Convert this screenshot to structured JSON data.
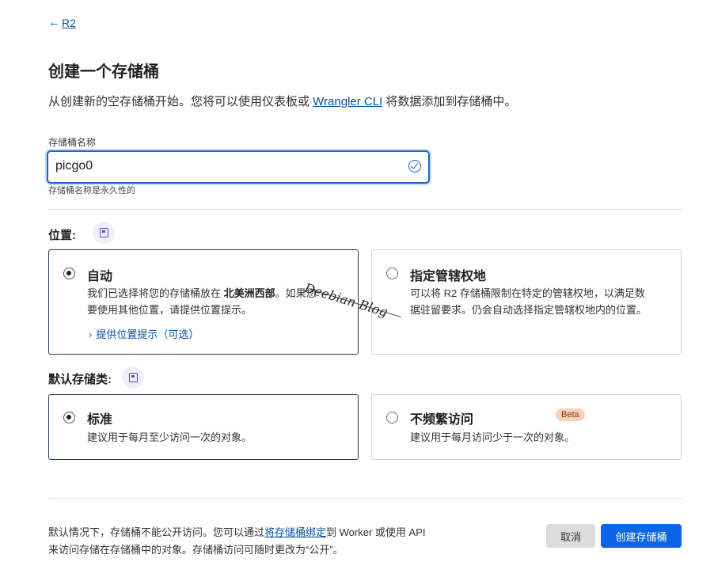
{
  "back": {
    "arrow": "←",
    "label": "R2"
  },
  "page": {
    "title": "创建一个存储桶",
    "subtitle_before": "从创建新的空存储桶开始。您将可以使用仪表板或 ",
    "subtitle_link": "Wrangler CLI",
    "subtitle_after": " 将数据添加到存储桶中。"
  },
  "bucket_name": {
    "label": "存储桶名称",
    "value": "picgo0",
    "hint": "存储桶名称是永久性的",
    "valid_icon": "check-circle-icon"
  },
  "location": {
    "label": "位置:",
    "options": [
      {
        "title": "自动",
        "desc_line1_before": "我们已选择将您的存储桶放在 ",
        "desc_line1_bold": "北美洲西部",
        "desc_line1_after": "。如果您",
        "desc_line2": "要使用其他位置，请提供位置提示。",
        "expander": "提供位置提示（可选）",
        "selected": true
      },
      {
        "title": "指定管辖权地",
        "desc_line1": "可以将 R2 存储桶限制在特定的管辖权地，以满足数",
        "desc_line2": "据驻留要求。仍会自动选择指定管辖权地内的位置。",
        "selected": false
      }
    ]
  },
  "storage_class": {
    "label": "默认存储类:",
    "options": [
      {
        "title": "标准",
        "desc": "建议用于每月至少访问一次的对象。",
        "selected": true
      },
      {
        "title": "不频繁访问",
        "badge": "Beta",
        "desc": "建议用于每月访问少于一次的对象。",
        "selected": false
      }
    ]
  },
  "footer": {
    "line1_before": "默认情况下，存储桶不能公开访问。您可以通过",
    "line1_link": "将存储桶绑定",
    "line1_after": "到 Worker 或使用 API",
    "line2": "来访问存储在存储桶中的对象。存储桶访问可随时更改为“公开”。",
    "cancel": "取消",
    "create": "创建存储桶"
  },
  "watermark": "Deebian Blog",
  "colors": {
    "accent": "#0a66e4",
    "link": "#0a4fa3",
    "badge_bg": "#f9d2b9"
  }
}
